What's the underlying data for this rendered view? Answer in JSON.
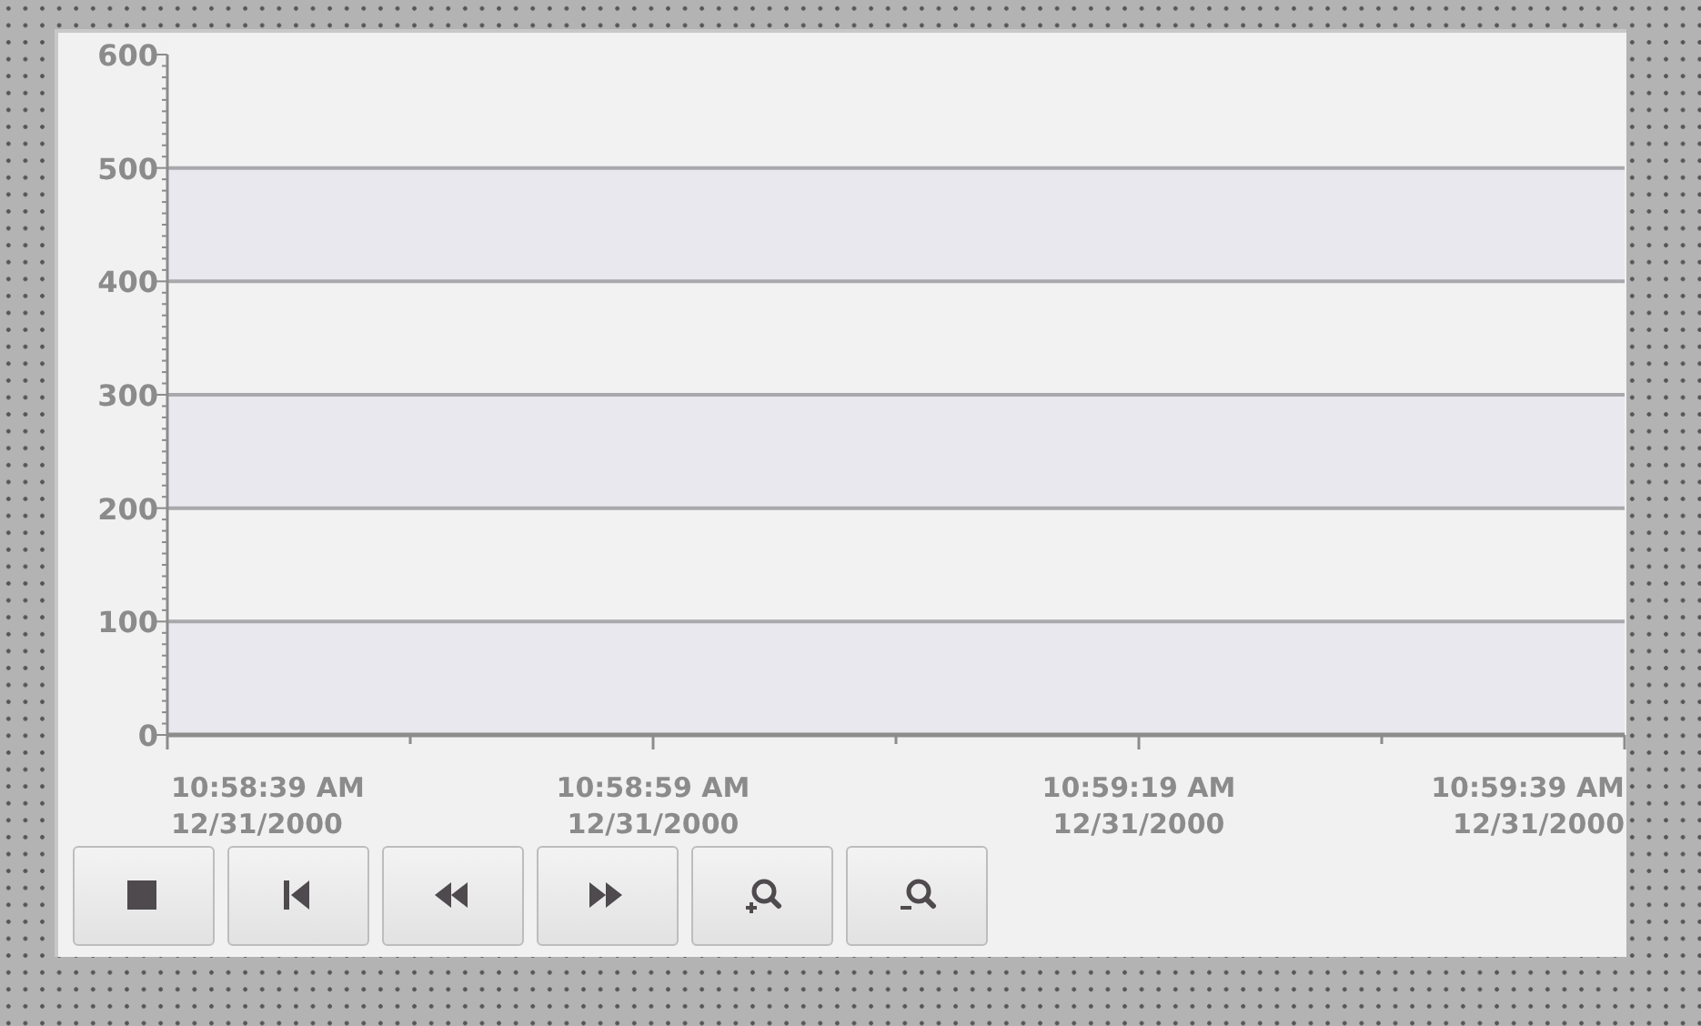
{
  "chart": {
    "chart_data": {
      "type": "line",
      "grid": true,
      "ylim": [
        0,
        600
      ],
      "yticks": [
        0,
        100,
        200,
        300,
        400,
        500,
        600
      ],
      "categories": [
        "10:58:39 AM\n12/31/2000",
        "10:58:59 AM\n12/31/2000",
        "10:59:19 AM\n12/31/2000",
        "10:59:39 AM\n12/31/2000"
      ]
    }
  },
  "buttons": [
    {
      "kind": "stop"
    },
    {
      "kind": "first"
    },
    {
      "kind": "rewind"
    },
    {
      "kind": "forward"
    },
    {
      "kind": "zoom_in"
    },
    {
      "kind": "zoom_out"
    }
  ]
}
